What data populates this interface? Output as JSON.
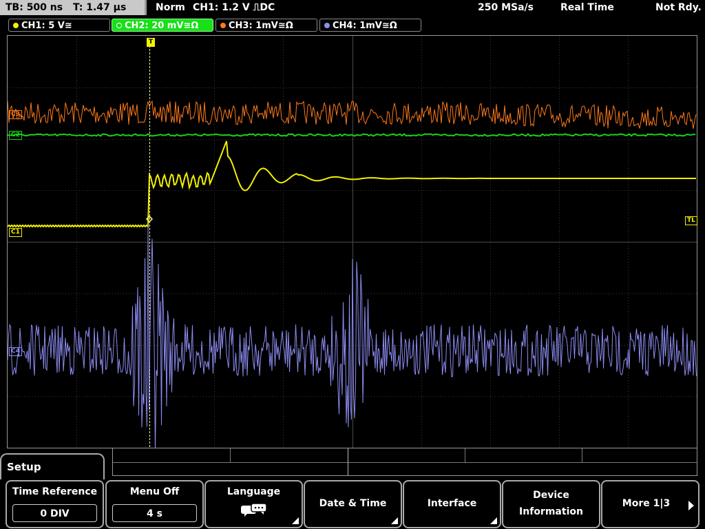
{
  "status": {
    "timebase": "TB: 500 ns",
    "trigger_time": "T: 1.47 µs",
    "mode": "Norm",
    "trigger_info": "CH1: 1.2 V ⎍DC",
    "sample_rate": "250 MSa/s",
    "acq_mode": "Real Time",
    "state": "Not Rdy."
  },
  "channels": [
    {
      "label": "CH1: 5 V≅",
      "color": "#f2f200"
    },
    {
      "label": "CH2: 20 mV≅Ω",
      "color": "#19d419"
    },
    {
      "label": "CH3: 1mV≅Ω",
      "color": "#ff7a1a"
    },
    {
      "label": "CH4: 1mV≅Ω",
      "color": "#8c8cf2"
    }
  ],
  "markers": {
    "ch1": "C1",
    "ch2": "C2",
    "ch3": "C3",
    "ch4": "C4",
    "trigger_level": "TL",
    "trigger_pos": "T"
  },
  "menu": {
    "setup": "Setup",
    "time_reference": {
      "label": "Time Reference",
      "value": "0 DIV"
    },
    "menu_off": {
      "label": "Menu Off",
      "value": "4 s"
    },
    "language": {
      "label": "Language",
      "icon": "speech-bubble-icon"
    },
    "date_time": "Date & Time",
    "interface": "Interface",
    "device_information": {
      "line1": "Device",
      "line2": "Information"
    },
    "more": "More 1|3"
  },
  "colors": {
    "ch1": "#f2f200",
    "ch2": "#19d419",
    "ch3": "#ff7a1a",
    "ch4": "#8c8cf2",
    "grid": "#3c3c3c"
  }
}
